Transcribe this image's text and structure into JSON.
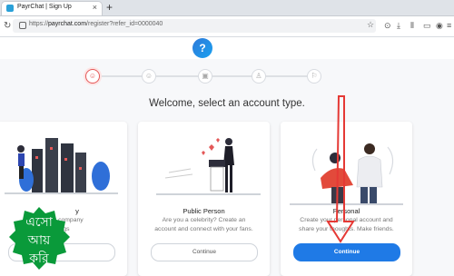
{
  "browser": {
    "tab_title": "PayrChat | Sign Up",
    "tab_close": "×",
    "new_tab": "+",
    "url_prefix": "https://",
    "url_host": "payrchat.com",
    "url_path": "/register?refer_id=0000040",
    "star": "☆"
  },
  "header": {
    "logo_glyph": "?"
  },
  "steps": [
    {
      "glyph": "☺"
    },
    {
      "glyph": "☺"
    },
    {
      "glyph": "▣"
    },
    {
      "glyph": "♙"
    },
    {
      "glyph": "⚐"
    }
  ],
  "page": {
    "welcome": "Welcome, select an account type."
  },
  "cards": [
    {
      "title": "y",
      "desc_1": "Cre ur company",
      "desc_2": "things",
      "button": ""
    },
    {
      "title": "Public Person",
      "desc_1": "Are you a celebrity? Create an",
      "desc_2": "account and connect with your fans.",
      "button": "Continue"
    },
    {
      "title": "Personal",
      "desc_1": "Create your personal account and",
      "desc_2": "share your thoughts. Make friends.",
      "button": "Continue"
    }
  ],
  "badge": {
    "text_line_1": "এসো",
    "text_line_2": "আয়",
    "text_line_3": "করি"
  },
  "colors": {
    "accent": "#1f7ae6",
    "annotation": "#e53935",
    "badge": "#0a9a3a"
  }
}
